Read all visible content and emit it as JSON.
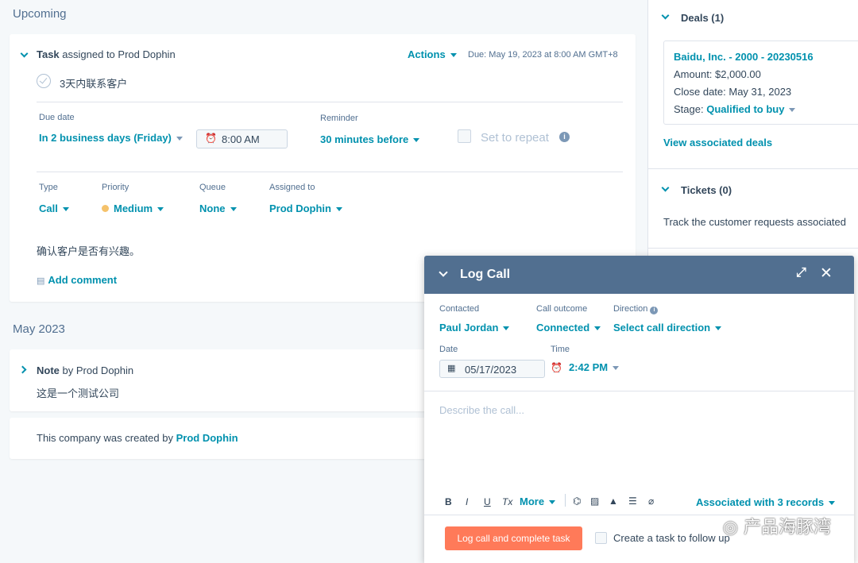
{
  "timeline": {
    "upcoming_title": "Upcoming",
    "task": {
      "type_bold": "Task",
      "assigned_text": "assigned to Prod Dophin",
      "actions_label": "Actions",
      "due_text": "Due: May 19, 2023 at 8:00 AM GMT+8",
      "task_title": "3天内联系客户",
      "due_date_label": "Due date",
      "due_date_value": "In 2 business days (Friday)",
      "time_value": "8:00 AM",
      "reminder_label": "Reminder",
      "reminder_value": "30 minutes before",
      "repeat_label": "Set to repeat",
      "type_label": "Type",
      "type_value": "Call",
      "priority_label": "Priority",
      "priority_value": "Medium",
      "priority_color": "#f5c26b",
      "queue_label": "Queue",
      "queue_value": "None",
      "assigned_label": "Assigned to",
      "assigned_value": "Prod Dophin",
      "note_text": "确认客户是否有兴趣。",
      "add_comment_label": "Add comment"
    },
    "month_title": "May 2023",
    "note": {
      "type_bold": "Note",
      "by_text": "by Prod Dophin",
      "body": "这是一个测试公司"
    },
    "created": {
      "prefix": "This company was created by",
      "author": "Prod Dophin"
    }
  },
  "sidebar": {
    "deals_title": "Deals (1)",
    "deal": {
      "name": "Baidu, Inc. - 2000 - 20230516",
      "amount": "Amount: $2,000.00",
      "close_date": "Close date: May 31, 2023",
      "stage_label": "Stage:",
      "stage_value": "Qualified to buy"
    },
    "view_deals_label": "View associated deals",
    "tickets_title": "Tickets (0)",
    "tickets_desc": "Track the customer requests associated"
  },
  "log_call": {
    "title": "Log Call",
    "contacted_label": "Contacted",
    "contacted_value": "Paul Jordan",
    "outcome_label": "Call outcome",
    "outcome_value": "Connected",
    "direction_label": "Direction",
    "direction_value": "Select call direction",
    "date_label": "Date",
    "date_value": "05/17/2023",
    "time_label": "Time",
    "time_value": "2:42 PM",
    "describe_placeholder": "Describe the call...",
    "toolbar": {
      "bold": "B",
      "italic": "I",
      "underline": "U",
      "clear": "Tx",
      "more": "More"
    },
    "associated_label": "Associated with 3 records",
    "submit_label": "Log call and complete task",
    "create_task_label": "Create a task to follow up"
  },
  "watermark_text": "产品海豚湾",
  "colors": {
    "accent": "#0091ae",
    "header": "#516f90",
    "submit": "#ff7a59"
  }
}
